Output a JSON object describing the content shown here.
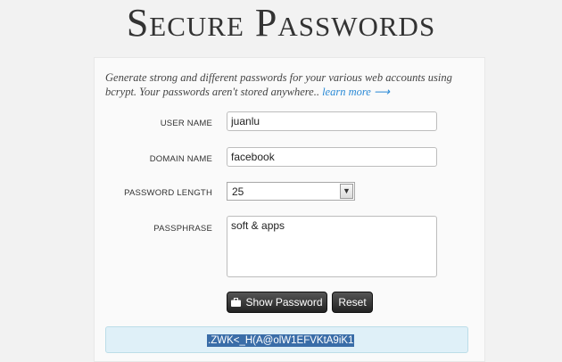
{
  "header": {
    "title": "Secure Passwords"
  },
  "intro": {
    "text": "Generate strong and different passwords for your various web accounts using bcrypt. Your passwords aren't stored anywhere..",
    "link": "learn more ⟶"
  },
  "form": {
    "user_label": "USER NAME",
    "user_value": "juanlu",
    "domain_label": "DOMAIN NAME",
    "domain_value": "facebook",
    "length_label": "PASSWORD LENGTH",
    "length_value": "25",
    "passphrase_label": "PASSPHRASE",
    "passphrase_value": "soft & apps"
  },
  "buttons": {
    "show_label": "Show Password",
    "reset_label": "Reset"
  },
  "result": {
    "password": ".ZWK<_H(A@olW1EFVKtA9iK1"
  },
  "icons": {
    "show_icon": "briefcase-icon",
    "select_arrow": "chevron-down-icon"
  }
}
